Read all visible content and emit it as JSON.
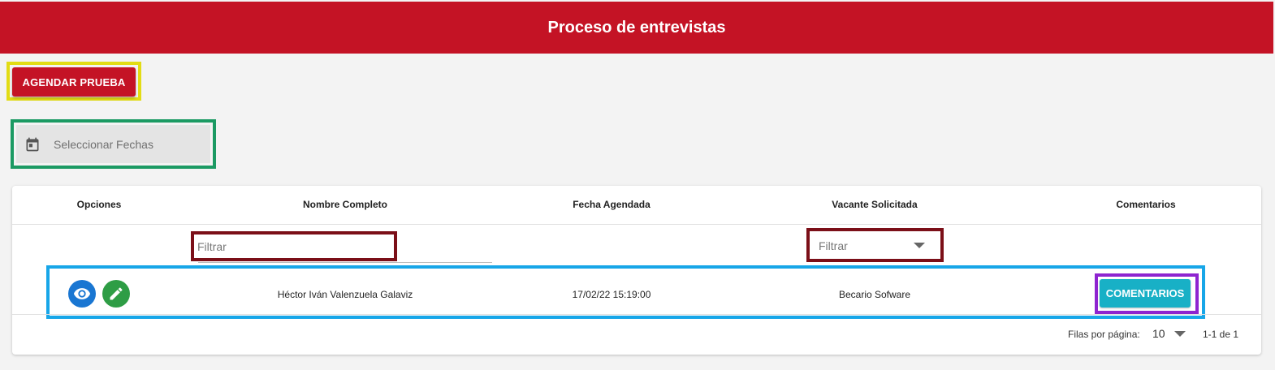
{
  "header": {
    "title": "Proceso de entrevistas"
  },
  "actions": {
    "schedule_label": "AGENDAR PRUEBA"
  },
  "date_picker": {
    "placeholder": "Seleccionar Fechas",
    "icon": "calendar-icon"
  },
  "table": {
    "columns": [
      "Opciones",
      "Nombre Completo",
      "Fecha Agendada",
      "Vacante Solicitada",
      "Comentarios"
    ],
    "filters": {
      "name_placeholder": "Filtrar",
      "vacancy_placeholder": "Filtrar"
    },
    "rows": [
      {
        "name": "Héctor Iván Valenzuela Galaviz",
        "date": "17/02/22 15:19:00",
        "vacancy": "Becario Sofware",
        "comments_label": "COMENTARIOS",
        "option_icons": [
          "eye-icon",
          "pencil-icon"
        ]
      }
    ],
    "pagination": {
      "rows_per_page_label": "Filas por página:",
      "rows_per_page": "10",
      "range": "1-1 de 1"
    }
  },
  "colors": {
    "brand": "#c41325",
    "view_button": "#1976d2",
    "edit_button": "#2e9d45",
    "comments_button": "#18b0c6"
  }
}
